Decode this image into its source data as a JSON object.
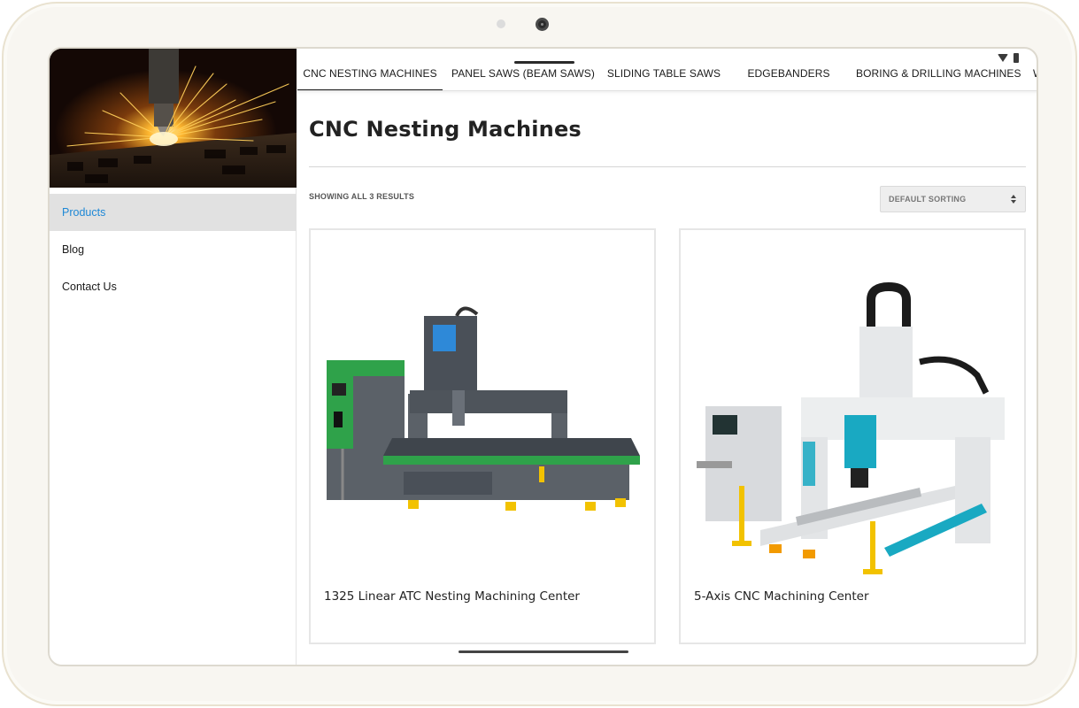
{
  "status_bar": {
    "icons": [
      "wifi-icon",
      "battery-icon"
    ]
  },
  "sidebar": {
    "hero_image": "laser-cutting-sparks-photo",
    "items": [
      {
        "label": "Products",
        "active": true
      },
      {
        "label": "Blog",
        "active": false
      },
      {
        "label": "Contact Us",
        "active": false
      }
    ]
  },
  "tabs": [
    {
      "label": "CNC NESTING MACHINES",
      "active": true
    },
    {
      "label": "PANEL SAWS (BEAM SAWS)",
      "active": false
    },
    {
      "label": "SLIDING TABLE SAWS",
      "active": false
    },
    {
      "label": "EDGEBANDERS",
      "active": false
    },
    {
      "label": "BORING & DRILLING MACHINES",
      "active": false
    },
    {
      "label": "W",
      "active": false
    }
  ],
  "main": {
    "title": "CNC Nesting Machines",
    "result_count": "SHOWING ALL 3 RESULTS",
    "sort_select": {
      "selected": "DEFAULT SORTING"
    },
    "products": [
      {
        "name": "1325 Linear ATC Nesting Machining Center",
        "image": "cnc-router-photo"
      },
      {
        "name": "5-Axis CNC Machining Center",
        "image": "5-axis-machine-photo"
      }
    ]
  },
  "colors": {
    "active_nav": "#1e88d6",
    "active_nav_bg": "#e1e1e1",
    "machine_green": "#2fa24a",
    "machine_grey": "#5b6168",
    "accent_yellow": "#f2c200",
    "accent_cyan": "#19a9c2"
  }
}
